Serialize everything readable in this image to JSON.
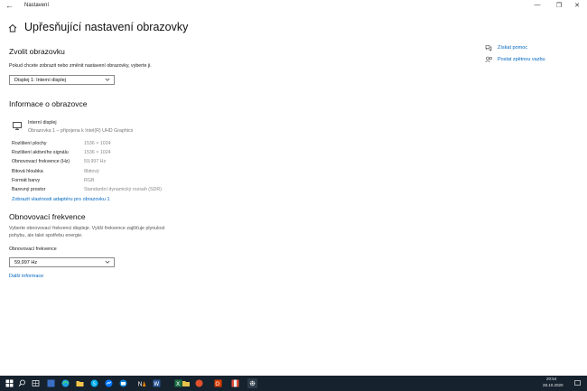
{
  "window": {
    "title": "Nastavení",
    "back_glyph": "←",
    "minimize_glyph": "—",
    "maximize_glyph": "❐",
    "close_glyph": "✕"
  },
  "page": {
    "title": "Upřesňující nastavení obrazovky"
  },
  "select_display": {
    "heading": "Zvolit obrazovku",
    "description": "Pokud chcete zobrazit nebo změnit nastavení obrazovky, vyberte ji.",
    "selected": "Displej 1: Interní displej"
  },
  "display_info": {
    "heading": "Informace o obrazovce",
    "monitor_name": "Interní displej",
    "monitor_sub": "Obrazovka 1 – připojena k Intel(R) UHD Graphics",
    "rows": [
      {
        "key": "Rozlišení plochy",
        "value": "1536 × 1024"
      },
      {
        "key": "Rozlišení aktivního signálu",
        "value": "1536 × 1024"
      },
      {
        "key": "Obnovovací frekvence (Hz)",
        "value": "59,997 Hz"
      },
      {
        "key": "Bitová hloubka",
        "value": "8bitový"
      },
      {
        "key": "Formát barvy",
        "value": "RGB"
      },
      {
        "key": "Barevný prostor",
        "value": "Standardní dynamický rozsah (SDR)"
      }
    ],
    "adapter_link": "Zobrazit vlastnosti adaptéru pro obrazovku 1"
  },
  "refresh": {
    "heading": "Obnovovací frekvence",
    "description_line1": "Vyberte obnovovací frekvenci displeje. Vyšší frekvence zajišťuje plynulost",
    "description_line2": "pohybu, ale také spotřebu energie.",
    "label": "Obnovovací frekvence",
    "selected": "59,997 Hz",
    "more_link": "Další informace"
  },
  "side": {
    "help": "Získat pomoc",
    "feedback": "Poslat zpětnou vazbu"
  },
  "taskbar": {
    "time": "20:54",
    "date": "28.10.2020",
    "icons": [
      "windows-start-icon",
      "search-icon",
      "task-view-icon",
      "edge-icon",
      "store-icon",
      "explorer-icon",
      "skype-icon",
      "messenger-icon",
      "mail-icon",
      "vlc-icon",
      "word-icon",
      "excel-icon",
      "folder-icon",
      "acrobat-icon",
      "office-icon",
      "photos-icon",
      "settings-icon"
    ]
  },
  "colors": {
    "accent": "#0067c0",
    "taskbar": "#16222e"
  }
}
